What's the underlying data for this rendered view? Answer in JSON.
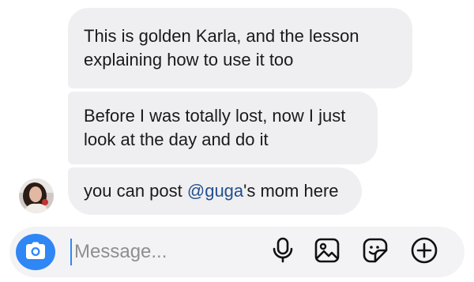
{
  "messages": [
    {
      "text": "This is golden Karla, and the lesson explaining how to use it too"
    },
    {
      "text": "Before I was totally lost, now I just look at the day and do it"
    },
    {
      "before": "you can post ",
      "mention": "@guga",
      "after": "'s mom here"
    }
  ],
  "composer": {
    "placeholder": "Message..."
  },
  "colors": {
    "accent": "#2f86f5",
    "bubble": "#efeff2",
    "mention": "#23508c",
    "composer_bg": "#f3f3f6"
  },
  "icons": [
    "camera-icon",
    "microphone-icon",
    "gallery-icon",
    "sticker-icon",
    "plus-icon"
  ]
}
